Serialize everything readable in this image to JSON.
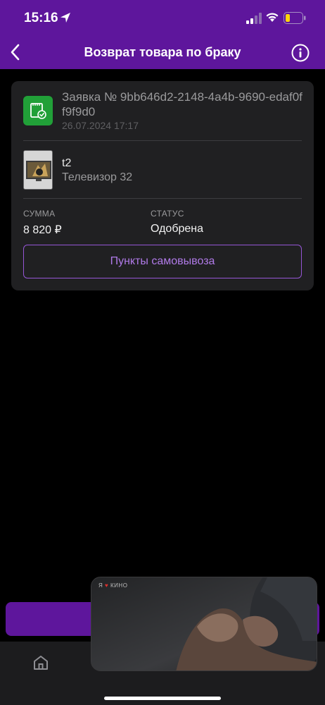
{
  "status_bar": {
    "time": "15:16"
  },
  "nav": {
    "title": "Возврат товара по браку"
  },
  "order": {
    "title": "Заявка № 9bb646d2-2148-4a4b-9690-edaf0ff9f9d0",
    "date": "26.07.2024 17:17"
  },
  "product": {
    "name": "t2",
    "description": "Телевизор 32"
  },
  "summary": {
    "sum_label": "СУММА",
    "sum_value": "8 820 ₽",
    "status_label": "СТАТУС",
    "status_value": "Одобрена"
  },
  "pickup_button": {
    "label": "Пункты самовывоза"
  },
  "video": {
    "logo_prefix": "Я",
    "logo_suffix": "КИНО"
  },
  "colors": {
    "header": "#5e169c",
    "card": "#202022",
    "accent": "#b07ae8",
    "success": "#21a038"
  },
  "icons": [
    "location-arrow-icon",
    "signal-icon",
    "wifi-icon",
    "battery-icon",
    "back-chevron-icon",
    "info-icon",
    "order-document-icon",
    "home-icon"
  ]
}
